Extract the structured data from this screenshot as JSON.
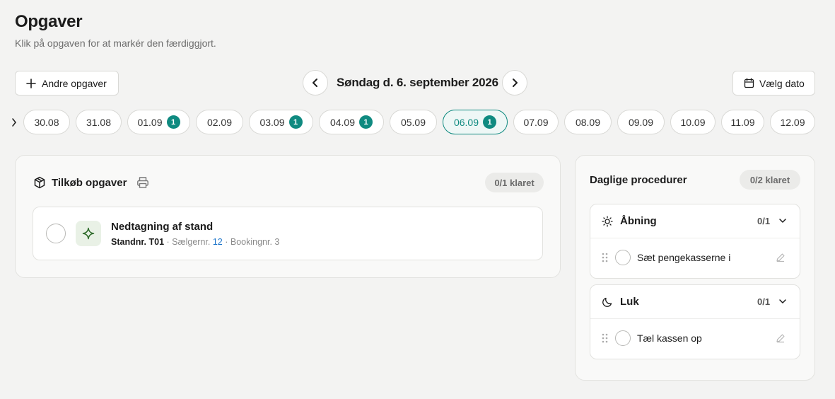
{
  "header": {
    "title": "Opgaver",
    "subtitle": "Klik på opgaven for at markér den færdiggjort."
  },
  "toolbar": {
    "other_tasks_label": "Andre opgaver",
    "current_date": "Søndag d. 6. september 2026",
    "choose_date_label": "Vælg dato"
  },
  "date_strip": [
    {
      "label": "30.08",
      "badge": null,
      "active": false
    },
    {
      "label": "31.08",
      "badge": null,
      "active": false
    },
    {
      "label": "01.09",
      "badge": "1",
      "active": false
    },
    {
      "label": "02.09",
      "badge": null,
      "active": false
    },
    {
      "label": "03.09",
      "badge": "1",
      "active": false
    },
    {
      "label": "04.09",
      "badge": "1",
      "active": false
    },
    {
      "label": "05.09",
      "badge": null,
      "active": false
    },
    {
      "label": "06.09",
      "badge": "1",
      "active": true
    },
    {
      "label": "07.09",
      "badge": null,
      "active": false
    },
    {
      "label": "08.09",
      "badge": null,
      "active": false
    },
    {
      "label": "09.09",
      "badge": null,
      "active": false
    },
    {
      "label": "10.09",
      "badge": null,
      "active": false
    },
    {
      "label": "11.09",
      "badge": null,
      "active": false
    },
    {
      "label": "12.09",
      "badge": null,
      "active": false
    }
  ],
  "addon_tasks": {
    "title": "Tilkøb opgaver",
    "progress": "0/1 klaret",
    "items": [
      {
        "title": "Nedtagning af stand",
        "stand": "Standnr. T01",
        "seller_label": "Sælgernr.",
        "seller_number": "12",
        "booking": "Bookingnr. 3"
      }
    ]
  },
  "daily": {
    "title": "Daglige procedurer",
    "progress": "0/2 klaret",
    "groups": [
      {
        "name": "Åbning",
        "count": "0/1",
        "items": [
          "Sæt pengekasserne i"
        ]
      },
      {
        "name": "Luk",
        "count": "0/1",
        "items": [
          "Tæl kassen op"
        ]
      }
    ]
  },
  "colors": {
    "accent": "#0f8a80",
    "link": "#1a73c9",
    "background": "#f3f3f2"
  },
  "icons": {
    "add": "plus-icon",
    "calendar": "calendar-icon",
    "prev": "chevron-left-icon",
    "next": "chevron-right-icon",
    "package": "package-icon",
    "print": "printer-icon",
    "task": "sparkle-icon",
    "open": "sun-icon",
    "close": "moon-icon",
    "expand": "chevron-down-icon",
    "drag": "drag-handle-icon",
    "edit": "pencil-icon"
  }
}
